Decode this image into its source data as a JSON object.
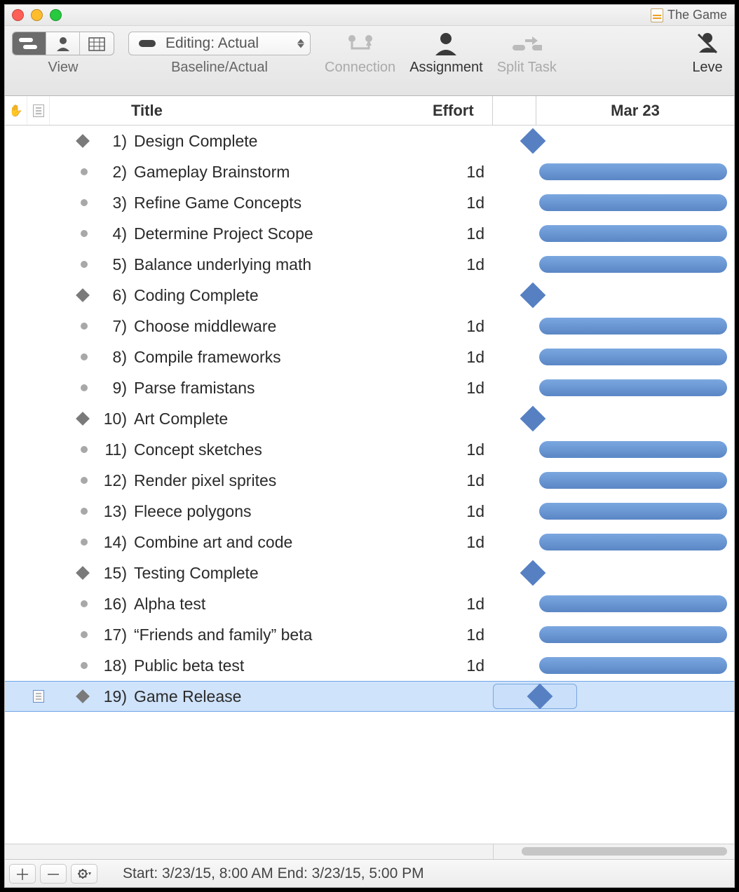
{
  "window": {
    "doc_title": "The Game"
  },
  "toolbar": {
    "view_label": "View",
    "baseline_label": "Baseline/Actual",
    "dropdown_text": "Editing: Actual",
    "connection_label": "Connection",
    "assignment_label": "Assignment",
    "split_label": "Split Task",
    "level_label": "Leve"
  },
  "columns": {
    "title": "Title",
    "effort": "Effort"
  },
  "gantt": {
    "date_header": "Mar 23"
  },
  "tasks": [
    {
      "num": "1)",
      "title": "Design Complete",
      "effort": "",
      "type": "milestone",
      "selected": false,
      "has_note": false
    },
    {
      "num": "2)",
      "title": "Gameplay Brainstorm",
      "effort": "1d",
      "type": "task",
      "selected": false,
      "has_note": false
    },
    {
      "num": "3)",
      "title": "Refine Game Concepts",
      "effort": "1d",
      "type": "task",
      "selected": false,
      "has_note": false
    },
    {
      "num": "4)",
      "title": "Determine Project Scope",
      "effort": "1d",
      "type": "task",
      "selected": false,
      "has_note": false
    },
    {
      "num": "5)",
      "title": "Balance underlying math",
      "effort": "1d",
      "type": "task",
      "selected": false,
      "has_note": false
    },
    {
      "num": "6)",
      "title": "Coding Complete",
      "effort": "",
      "type": "milestone",
      "selected": false,
      "has_note": false
    },
    {
      "num": "7)",
      "title": "Choose middleware",
      "effort": "1d",
      "type": "task",
      "selected": false,
      "has_note": false
    },
    {
      "num": "8)",
      "title": "Compile frameworks",
      "effort": "1d",
      "type": "task",
      "selected": false,
      "has_note": false
    },
    {
      "num": "9)",
      "title": "Parse framistans",
      "effort": "1d",
      "type": "task",
      "selected": false,
      "has_note": false
    },
    {
      "num": "10)",
      "title": "Art Complete",
      "effort": "",
      "type": "milestone",
      "selected": false,
      "has_note": false
    },
    {
      "num": "11)",
      "title": "Concept sketches",
      "effort": "1d",
      "type": "task",
      "selected": false,
      "has_note": false
    },
    {
      "num": "12)",
      "title": "Render pixel sprites",
      "effort": "1d",
      "type": "task",
      "selected": false,
      "has_note": false
    },
    {
      "num": "13)",
      "title": "Fleece polygons",
      "effort": "1d",
      "type": "task",
      "selected": false,
      "has_note": false
    },
    {
      "num": "14)",
      "title": "Combine art and code",
      "effort": "1d",
      "type": "task",
      "selected": false,
      "has_note": false
    },
    {
      "num": "15)",
      "title": "Testing Complete",
      "effort": "",
      "type": "milestone",
      "selected": false,
      "has_note": false
    },
    {
      "num": "16)",
      "title": "Alpha test",
      "effort": "1d",
      "type": "task",
      "selected": false,
      "has_note": false
    },
    {
      "num": "17)",
      "title": "“Friends and family” beta",
      "effort": "1d",
      "type": "task",
      "selected": false,
      "has_note": false
    },
    {
      "num": "18)",
      "title": "Public beta test",
      "effort": "1d",
      "type": "task",
      "selected": false,
      "has_note": false
    },
    {
      "num": "19)",
      "title": "Game Release",
      "effort": "",
      "type": "milestone",
      "selected": true,
      "has_note": true
    }
  ],
  "statusbar": {
    "text": "Start: 3/23/15, 8:00 AM End: 3/23/15, 5:00 PM"
  }
}
